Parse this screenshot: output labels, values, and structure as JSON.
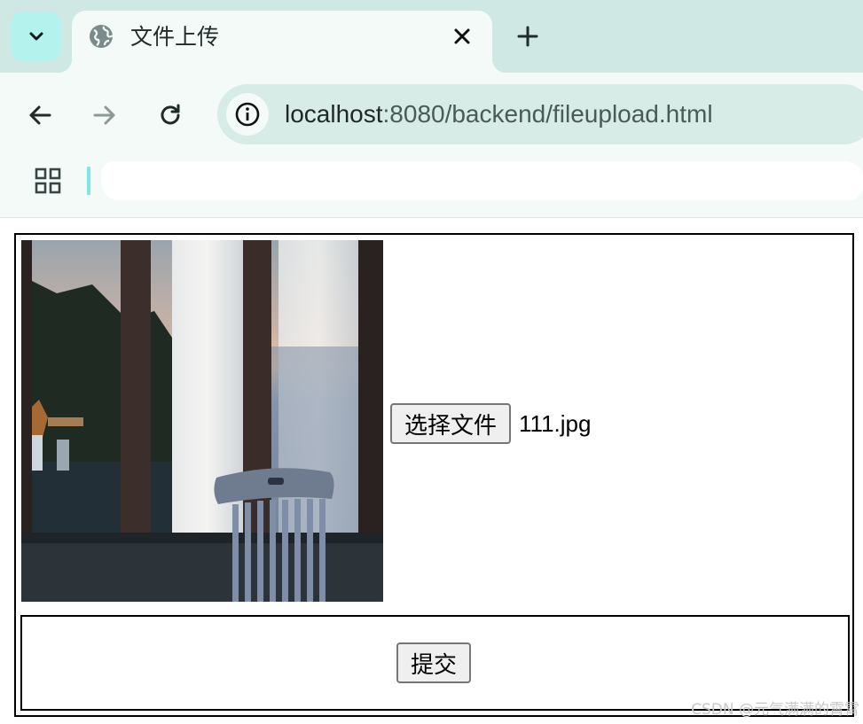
{
  "browser": {
    "tab": {
      "title": "文件上传",
      "favicon": "globe-icon"
    },
    "address_bar": {
      "host": "localhost",
      "rest": ":8080/backend/fileupload.html"
    },
    "icons": {
      "tab_search": "chevron-down-icon",
      "close": "close-icon",
      "new_tab": "plus-icon",
      "back": "back-arrow-icon",
      "forward": "forward-arrow-icon",
      "reload": "reload-icon",
      "site_info": "info-icon",
      "apps": "apps-grid-icon"
    }
  },
  "form": {
    "choose_file_label": "选择文件",
    "selected_file": "111.jpg",
    "submit_label": "提交"
  },
  "watermark": "CSDN @元气满满的霄霄",
  "colors": {
    "chrome_bg": "#cfe8e3",
    "toolbar_bg": "#f3faf8",
    "omnibox_bg": "#d7ebe7",
    "accent": "#b4f2ee"
  }
}
